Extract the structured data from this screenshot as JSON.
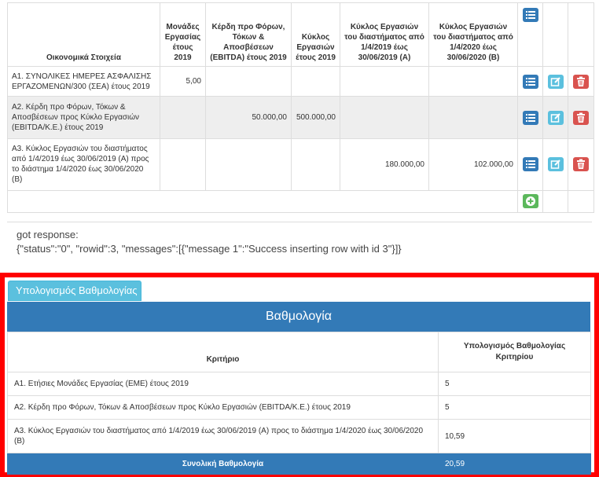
{
  "fin_table": {
    "headers": {
      "label": "Οικονομικά Στοιχεία",
      "units": "Μονάδες Εργασίας έτους 2019",
      "ebitda": "Κέρδη προ Φόρων, Τόκων & Αποσβέσεων (EBITDA) έτους 2019",
      "turnover": "Κύκλος Εργασιών έτους 2019",
      "period_a": "Κύκλος Εργασιών του διαστήματος από 1/4/2019 έως 30/06/2019 (Α)",
      "period_b": "Κύκλος Εργασιών του διαστήματος από 1/4/2020 έως 30/06/2020 (Β)"
    },
    "rows": [
      {
        "label": "Α1. ΣΥΝΟΛΙΚΕΣ ΗΜΕΡΕΣ ΑΣΦΑΛΙΣΗΣ ΕΡΓΑΖΟΜΕΝΩΝ/300 (ΣΕΑ) έτους 2019",
        "units": "5,00",
        "ebitda": "",
        "turnover": "",
        "period_a": "",
        "period_b": ""
      },
      {
        "label": "Α2. Κέρδη προ Φόρων, Τόκων & Αποσβέσεων προς Κύκλο Εργασιών (EBITDA/K.E.) έτους 2019",
        "units": "",
        "ebitda": "50.000,00",
        "turnover": "500.000,00",
        "period_a": "",
        "period_b": ""
      },
      {
        "label": "Α3. Κύκλος Εργασιών του διαστήματος από 1/4/2019 έως 30/06/2019 (Α) προς το διάστημα 1/4/2020 έως 30/06/2020 (Β)",
        "units": "",
        "ebitda": "",
        "turnover": "",
        "period_a": "180.000,00",
        "period_b": "102.000,00"
      }
    ]
  },
  "response": {
    "line1": "got response:",
    "line2": "{\"status\":\"0\", \"rowid\":3, \"messages\":[{\"message 1\":\"Success inserting row with id 3\"}]}"
  },
  "scoring": {
    "tab_label": "Υπολογισμός Βαθμολογίας",
    "title": "Βαθμολογία",
    "col_criterion": "Κριτήριο",
    "col_score": "Υπολογισμός Βαθμολογίας Κριτηρίου",
    "rows": [
      {
        "criterion": "Α1. Ετήσιες Μονάδες Εργασίας (ΕΜΕ) έτους 2019",
        "score": "5"
      },
      {
        "criterion": "Α2. Κέρδη προ Φόρων, Τόκων & Αποσβέσεων προς Κύκλο Εργασιών (EBITDA/K.E.) έτους 2019",
        "score": "5"
      },
      {
        "criterion": "Α3. Κύκλος Εργασιών του διαστήματος από 1/4/2019 έως 30/06/2019 (Α) προς το διάστημα 1/4/2020 έως 30/06/2020 (Β)",
        "score": "10,59"
      }
    ],
    "total_label": "Συνολική Βαθμολογία",
    "total_value": "20,59"
  },
  "colors": {
    "primary": "#337ab7",
    "info": "#5bc0de",
    "danger": "#d9534f",
    "success": "#5cb85c",
    "highlight": "#ff0000"
  },
  "icons": {
    "list": "list-icon",
    "edit": "edit-icon",
    "delete": "trash-icon",
    "add": "plus-circle-icon"
  }
}
